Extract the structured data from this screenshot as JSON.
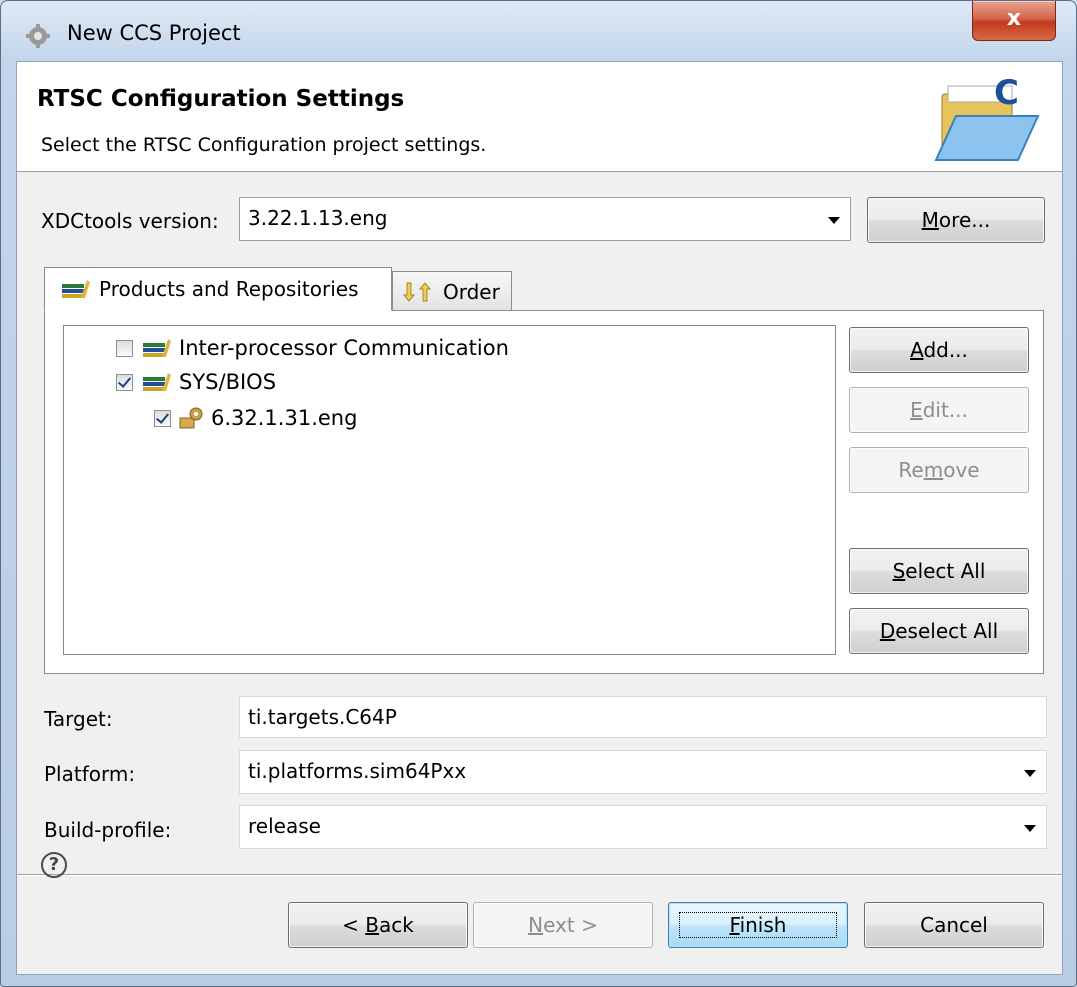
{
  "window": {
    "title": "New CCS Project",
    "close_label": "x"
  },
  "banner": {
    "title": "RTSC Configuration Settings",
    "description": "Select the RTSC Configuration project settings."
  },
  "xdctools": {
    "label": "XDCtools version:",
    "value": "3.22.1.13.eng",
    "more_prefix": "",
    "more_mnemonic": "M",
    "more_rest": "ore..."
  },
  "tabs": [
    {
      "label": "Products and Repositories",
      "selected": true
    },
    {
      "label": "Order",
      "selected": false
    }
  ],
  "tree": {
    "items": [
      {
        "label": "Inter-processor Communication",
        "checked": false,
        "level": 0
      },
      {
        "label": "SYS/BIOS",
        "checked": true,
        "level": 0
      },
      {
        "label": "6.32.1.31.eng",
        "checked": true,
        "level": 1
      }
    ]
  },
  "side_buttons": {
    "add": {
      "pre": "",
      "mn": "A",
      "post": "dd...",
      "enabled": true
    },
    "edit": {
      "pre": "",
      "mn": "E",
      "post": "dit...",
      "enabled": false
    },
    "remove": {
      "pre": "Re",
      "mn": "m",
      "post": "ove",
      "enabled": false
    },
    "select_all": {
      "pre": "",
      "mn": "S",
      "post": "elect All",
      "enabled": true
    },
    "deselect_all": {
      "pre": "",
      "mn": "D",
      "post": "eselect All",
      "enabled": true
    }
  },
  "settings": {
    "target": {
      "label": "Target:",
      "value": "ti.targets.C64P"
    },
    "platform": {
      "label": "Platform:",
      "value": "ti.platforms.sim64Pxx"
    },
    "build_profile": {
      "label": "Build-profile:",
      "value": "release"
    }
  },
  "footer": {
    "help": "?",
    "back": {
      "pre": "< ",
      "mn": "B",
      "post": "ack",
      "enabled": true
    },
    "next": {
      "pre": "",
      "mn": "N",
      "post": "ext >",
      "enabled": false
    },
    "finish": {
      "pre": "",
      "mn": "F",
      "post": "inish",
      "enabled": true
    },
    "cancel": {
      "label": "Cancel",
      "enabled": true
    }
  }
}
